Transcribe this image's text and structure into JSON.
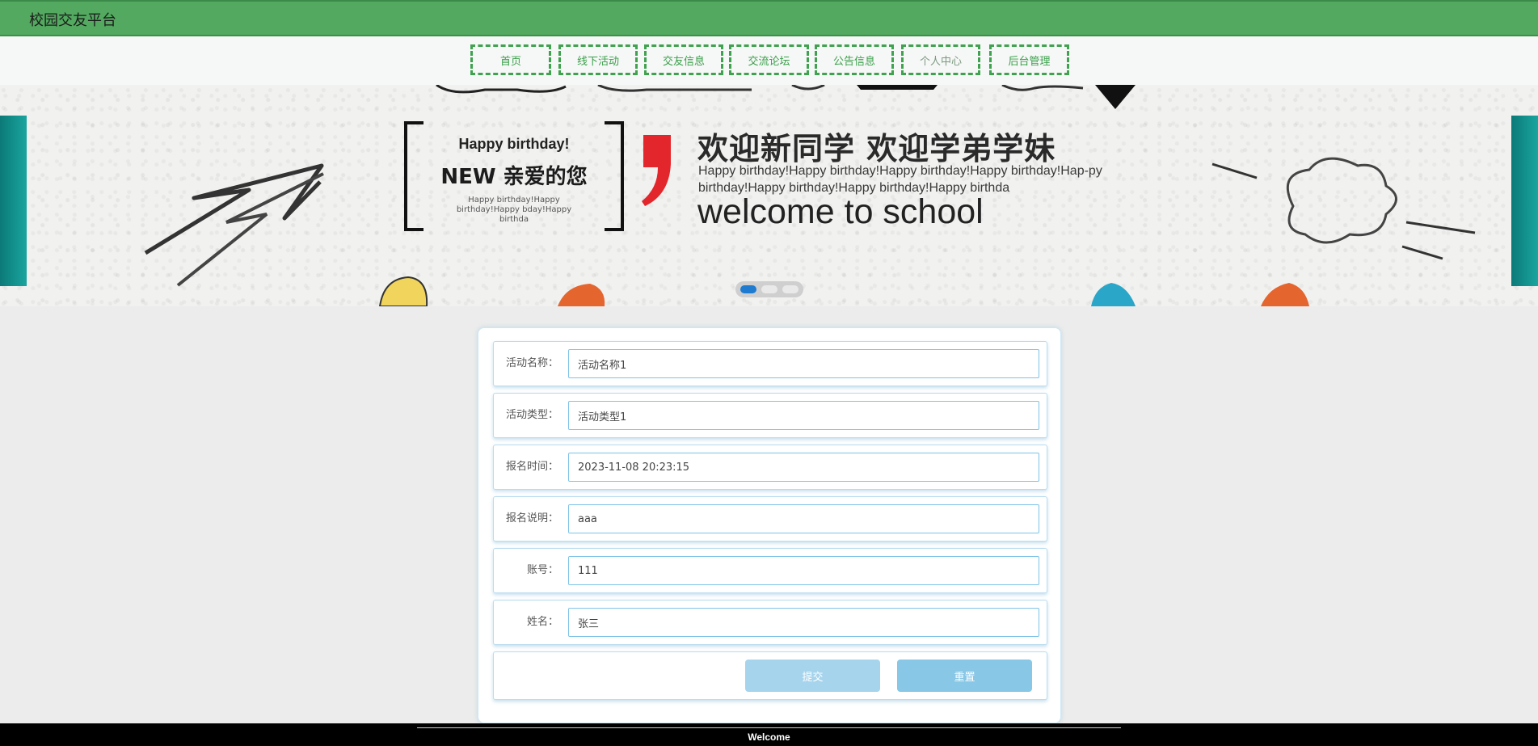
{
  "header": {
    "title": "校园交友平台",
    "bg_color": "#52a95f"
  },
  "nav": {
    "items": [
      {
        "label": "首页"
      },
      {
        "label": "线下活动"
      },
      {
        "label": "交友信息"
      },
      {
        "label": "交流论坛"
      },
      {
        "label": "公告信息"
      },
      {
        "label": "个人中心"
      },
      {
        "label": "后台管理"
      }
    ],
    "accent_color": "#3fa24e"
  },
  "banner": {
    "box_line1": "Happy birthday!",
    "box_line2": "NEW 亲爱的您",
    "box_small": "Happy birthday!Happy birthday!Happy bday!Happy birthda",
    "welcome_cn": "欢迎新同学 欢迎学弟学妹",
    "welcome_sub": "Happy birthday!Happy birthday!Happy birthday!Happy birthday!Hap-py birthday!Happy birthday!Happy birthday!Happy birthda",
    "welcome_en": "welcome to school",
    "slides_total": 3,
    "active_slide": 1
  },
  "form": {
    "fields": [
      {
        "label": "活动名称：",
        "value": "活动名称1"
      },
      {
        "label": "活动类型：",
        "value": "活动类型1"
      },
      {
        "label": "报名时间：",
        "value": "2023-11-08 20:23:15"
      },
      {
        "label": "报名说明：",
        "value": "aaa"
      },
      {
        "label": "账号：",
        "value": "111"
      },
      {
        "label": "姓名：",
        "value": "张三"
      }
    ],
    "submit_label": "提交",
    "reset_label": "重置"
  },
  "footer": {
    "text": "Welcome"
  }
}
